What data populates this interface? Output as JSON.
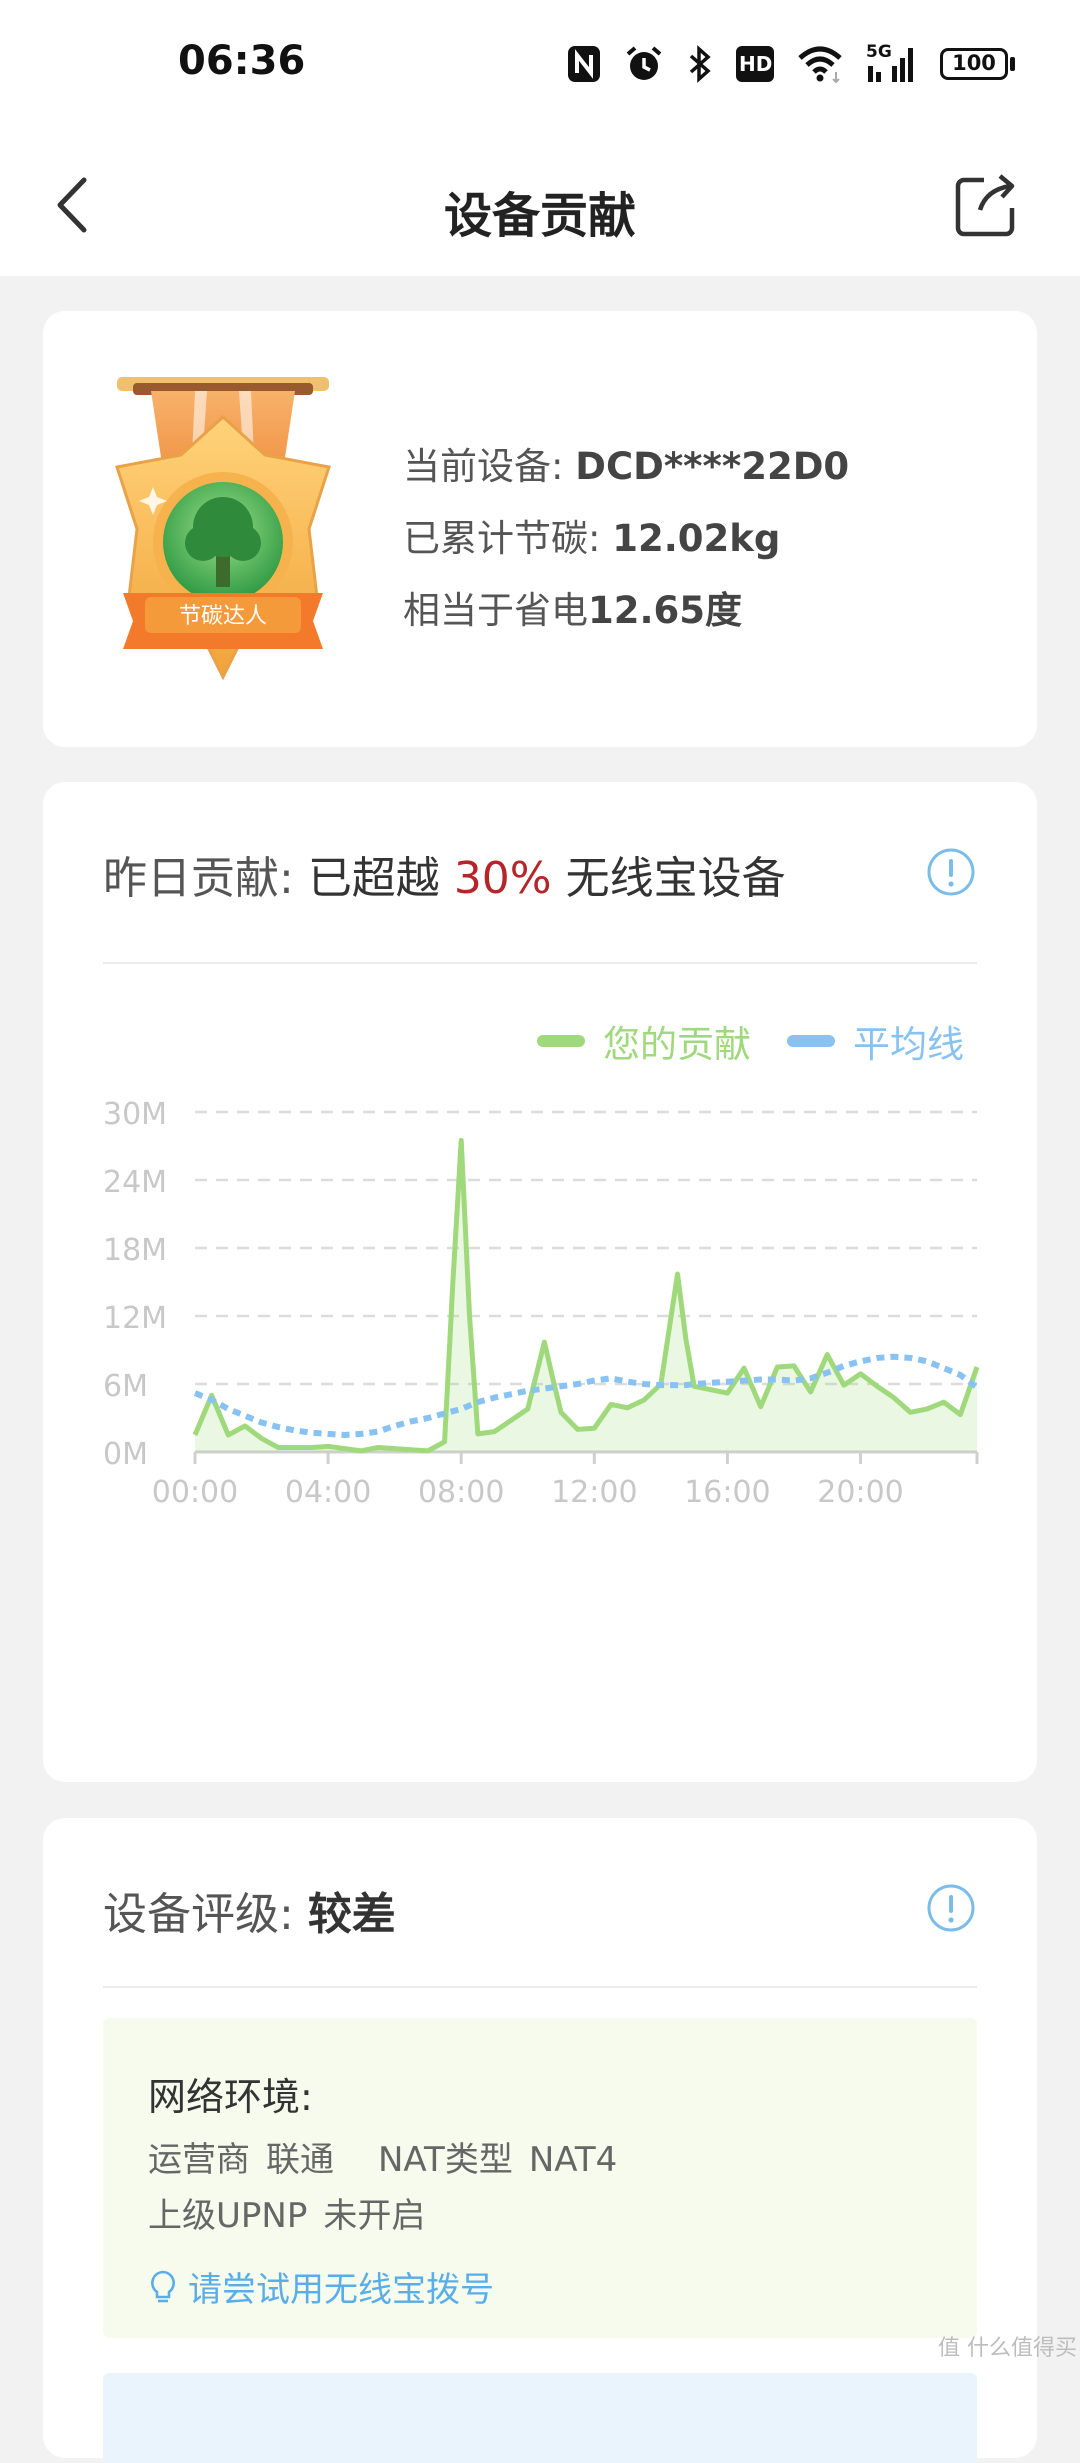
{
  "status_bar": {
    "time": "06:36",
    "icons": [
      "nfc-icon",
      "alarm-icon",
      "bluetooth-icon",
      "hd-icon",
      "wifi-icon",
      "signal-5g-icon"
    ],
    "network_label": "5G",
    "hd_label": "HD",
    "battery": "100"
  },
  "header": {
    "title": "设备贡献",
    "back_icon": "chevron-left-icon",
    "share_icon": "share-icon"
  },
  "device_card": {
    "badge_label": "节碳达人",
    "device": {
      "label": "当前设备: ",
      "value": "DCD****22D0"
    },
    "carbon": {
      "label": "已累计节碳: ",
      "value": "12.02kg"
    },
    "power": {
      "label": "相当于省电",
      "value": "12.65度"
    }
  },
  "contribution_card": {
    "heading_label": "昨日贡献: ",
    "heading_prefix": "已超越 ",
    "percent": "30%",
    "heading_suffix": " 无线宝设备",
    "legend": {
      "yours": "您的贡献",
      "average": "平均线"
    },
    "colors": {
      "yours": "#9fd97c",
      "average": "#88c2f2",
      "percent": "#b5252a"
    }
  },
  "chart_data": {
    "type": "line",
    "title": "",
    "xlabel": "",
    "ylabel": "",
    "x": [
      0,
      0.5,
      1,
      1.5,
      2,
      2.5,
      3,
      3.5,
      4,
      4.5,
      5,
      5.5,
      6,
      6.5,
      7,
      7.5,
      7.75,
      8,
      8.25,
      8.5,
      9,
      9.5,
      10,
      10.5,
      10.75,
      11,
      11.5,
      12,
      12.5,
      13,
      13.5,
      14,
      14.5,
      14.75,
      15,
      15.5,
      16,
      16.5,
      17,
      17.5,
      18,
      18.5,
      19,
      19.5,
      20,
      20.5,
      21,
      21.5,
      22,
      22.5,
      23,
      23.5
    ],
    "x_tick_labels": [
      "00:00",
      "04:00",
      "08:00",
      "12:00",
      "16:00",
      "20:00"
    ],
    "x_ticks": [
      0,
      4,
      8,
      12,
      16,
      20
    ],
    "xlim": [
      0,
      23.5
    ],
    "y_tick_labels": [
      "0M",
      "6M",
      "12M",
      "18M",
      "24M",
      "30M"
    ],
    "y_ticks": [
      0,
      6,
      12,
      18,
      24,
      30
    ],
    "ylim": [
      0,
      30
    ],
    "grid": true,
    "legend_position": "top-right",
    "series": [
      {
        "name": "您的贡献",
        "values": [
          1.5,
          5.0,
          1.5,
          2.3,
          1.2,
          0.4,
          0.4,
          0.4,
          0.5,
          0.3,
          0.1,
          0.4,
          0.3,
          0.2,
          0.1,
          0.9,
          15.0,
          27.5,
          12.0,
          1.6,
          1.8,
          2.8,
          3.8,
          9.7,
          6.5,
          3.5,
          2.0,
          2.1,
          4.2,
          3.9,
          4.6,
          6.0,
          15.7,
          10.0,
          5.8,
          5.5,
          5.2,
          7.4,
          4.0,
          7.5,
          7.6,
          5.3,
          8.6,
          5.9,
          6.9,
          5.8,
          4.8,
          3.5,
          3.8,
          4.4,
          3.3,
          7.5
        ]
      },
      {
        "name": "平均线",
        "values": [
          5.2,
          4.6,
          3.8,
          3.2,
          2.6,
          2.2,
          1.9,
          1.7,
          1.6,
          1.5,
          1.6,
          1.8,
          2.3,
          2.7,
          3.0,
          3.4,
          3.6,
          3.8,
          4.1,
          4.4,
          4.8,
          5.1,
          5.4,
          5.6,
          5.7,
          5.8,
          6.0,
          6.3,
          6.5,
          6.2,
          6.0,
          5.9,
          5.9,
          5.9,
          6.0,
          6.1,
          6.2,
          6.3,
          6.4,
          6.4,
          6.3,
          6.5,
          7.0,
          7.6,
          8.0,
          8.3,
          8.4,
          8.3,
          8.0,
          7.4,
          6.8,
          5.7
        ]
      }
    ]
  },
  "rating_card": {
    "heading_label": "设备评级: ",
    "rating": "较差",
    "network": {
      "title": "网络环境:",
      "isp_label": "运营商",
      "isp_value": "联通",
      "nat_label": "NAT类型",
      "nat_value": "NAT4",
      "upnp_label": "上级UPNP",
      "upnp_value": "未开启",
      "tip": "请尝试用无线宝拨号",
      "tip_icon": "lightbulb-icon"
    }
  },
  "watermark": "值 什么值得买"
}
